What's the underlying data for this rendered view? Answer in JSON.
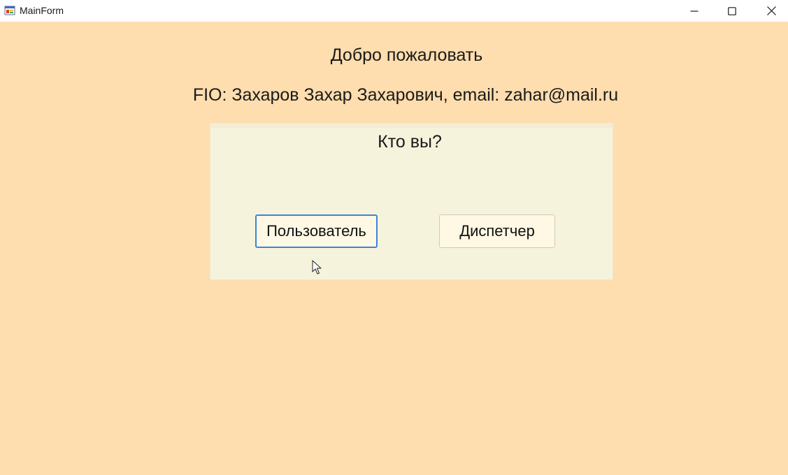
{
  "window": {
    "title": "MainForm",
    "controls": {
      "minimize_icon": "minimize-icon",
      "maximize_icon": "maximize-icon",
      "close_icon": "close-icon"
    }
  },
  "main": {
    "welcome": "Добро пожаловать",
    "user_info": "FIO: Захаров Захар Захарович, email: zahar@mail.ru",
    "role_panel": {
      "title": "Кто вы?",
      "buttons": {
        "user": "Пользователь",
        "dispatcher": "Диспетчер"
      }
    }
  },
  "colors": {
    "background": "#FEDDAE",
    "panel": "#F6F3DC",
    "focus_border": "#3A86D8"
  }
}
